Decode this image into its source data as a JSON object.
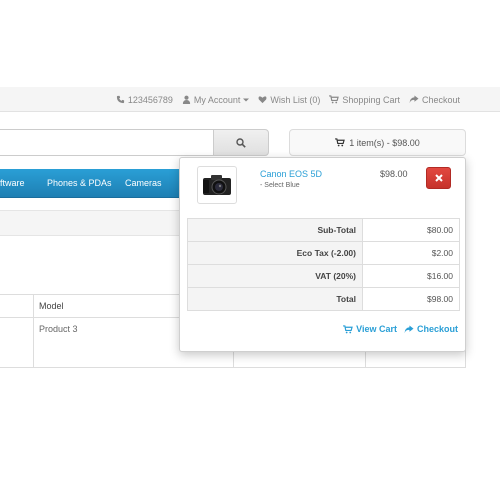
{
  "topbar": {
    "phone": "123456789",
    "my_account": "My Account",
    "wishlist": "Wish List (0)",
    "shopping_cart": "Shopping Cart",
    "checkout": "Checkout"
  },
  "search": {
    "placeholder": ""
  },
  "cart_button": {
    "label": "1 item(s) - $98.00"
  },
  "nav": {
    "items": [
      "ftware",
      "Phones & PDAs",
      "Cameras"
    ]
  },
  "table": {
    "headers": [
      "Model"
    ],
    "rows": [
      [
        "Product 3"
      ]
    ]
  },
  "cart_dropdown": {
    "product": {
      "name": "Canon EOS 5D",
      "option": "- Select Blue",
      "price": "$98.00"
    },
    "totals": [
      {
        "label": "Sub-Total",
        "value": "$80.00"
      },
      {
        "label": "Eco Tax (-2.00)",
        "value": "$2.00"
      },
      {
        "label": "VAT (20%)",
        "value": "$16.00"
      },
      {
        "label": "Total",
        "value": "$98.00"
      }
    ],
    "view_cart": "View Cart",
    "checkout": "Checkout"
  },
  "colors": {
    "accent": "#2a9fd6",
    "nav_bg": "#2286c0",
    "danger": "#d9443c"
  }
}
